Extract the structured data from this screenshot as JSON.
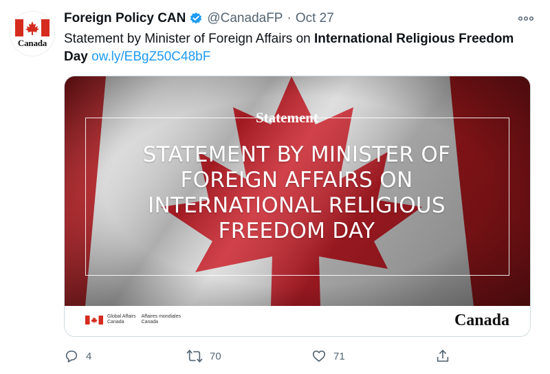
{
  "account": {
    "name": "Foreign Policy CAN",
    "handle": "@CanadaFP",
    "separator": "·",
    "date": "Oct 27",
    "avatar_wordmark": "Canada"
  },
  "tweet": {
    "text_plain": "Statement by Minister of Foreign Affairs on ",
    "text_bold": "International Religious Freedom Day",
    "link": "ow.ly/EBgZ50C48bF"
  },
  "card": {
    "label": "Statement",
    "headline": "STATEMENT BY MINISTER OF FOREIGN AFFAIRS ON INTERNATIONAL RELIGIOUS FREEDOM DAY",
    "footer_en_1": "Global Affairs",
    "footer_en_2": "Canada",
    "footer_fr_1": "Affaires mondiales",
    "footer_fr_2": "Canada",
    "wordmark": "Canada"
  },
  "actions": {
    "reply_count": "4",
    "retweet_count": "70",
    "like_count": "71"
  },
  "colors": {
    "flag_red": "#d52b1e",
    "link_blue": "#1d9bf0",
    "verified_blue": "#1d9bf0",
    "muted": "#536471"
  },
  "icons": [
    "canada-flag-icon",
    "verified-badge-icon",
    "more-icon",
    "reply-icon",
    "retweet-icon",
    "like-icon",
    "share-icon"
  ]
}
